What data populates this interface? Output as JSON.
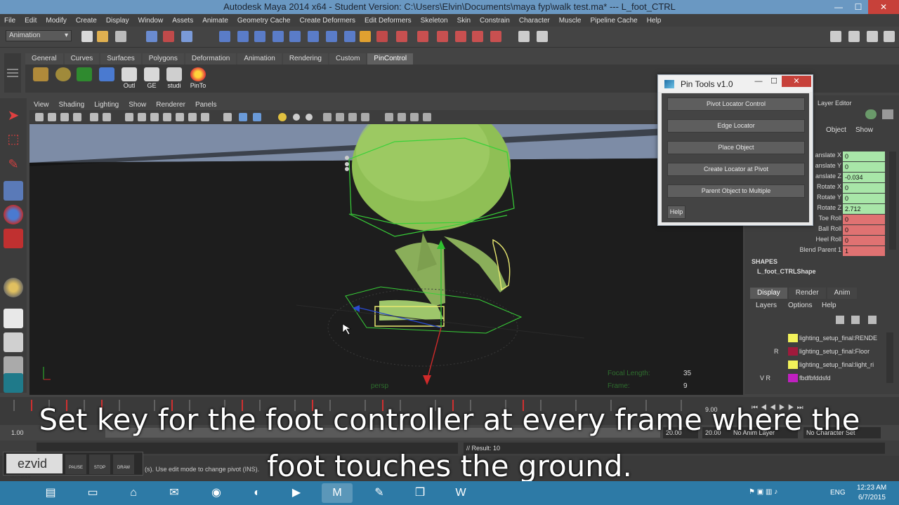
{
  "window": {
    "title": "Autodesk Maya 2014 x64 - Student Version: C:\\Users\\Elvin\\Documents\\maya fyp\\walk test.ma*   ---   L_foot_CTRL",
    "minimize": "—",
    "maximize": "☐",
    "close": "✕"
  },
  "menu": [
    "File",
    "Edit",
    "Modify",
    "Create",
    "Display",
    "Window",
    "Assets",
    "Animate",
    "Geometry Cache",
    "Create Deformers",
    "Edit Deformers",
    "Skeleton",
    "Skin",
    "Constrain",
    "Character",
    "Muscle",
    "Pipeline Cache",
    "Help"
  ],
  "status_line": {
    "mode": "Animation"
  },
  "shelf": {
    "tabs": [
      "General",
      "Curves",
      "Surfaces",
      "Polygons",
      "Deformation",
      "Animation",
      "Rendering",
      "Custom",
      "PinControl"
    ],
    "active_tab": "PinControl",
    "buttons": [
      "",
      "",
      "",
      "",
      "Outl",
      "GE",
      "studi",
      "PinTo"
    ]
  },
  "panel_menu": [
    "View",
    "Shading",
    "Lighting",
    "Show",
    "Renderer",
    "Panels"
  ],
  "viewport": {
    "hud": {
      "focal_length_label": "Focal Length:",
      "focal_length": "35",
      "frame_label": "Frame:",
      "frame": "9",
      "camera": "persp"
    }
  },
  "pin_tools": {
    "title": "Pin Tools v1.0",
    "buttons": [
      "Pivot Locator Control",
      "Edge Locator",
      "Place Object",
      "Create Locator at Pivot",
      "Parent Object to Multiple"
    ],
    "help": "Help"
  },
  "channel_box": {
    "header": "Layer Editor",
    "tabs": [
      "Object",
      "Show"
    ],
    "attributes": [
      {
        "label": "anslate X",
        "value": "0",
        "color": "green"
      },
      {
        "label": "anslate Y",
        "value": "0",
        "color": "green"
      },
      {
        "label": "anslate Z",
        "value": "-0.034",
        "color": "green"
      },
      {
        "label": "Rotate X",
        "value": "0",
        "color": "green"
      },
      {
        "label": "Rotate Y",
        "value": "0",
        "color": "green"
      },
      {
        "label": "Rotate Z",
        "value": "2.712",
        "color": "green"
      },
      {
        "label": "Toe Roll",
        "value": "0",
        "color": "red"
      },
      {
        "label": "Ball Roll",
        "value": "0",
        "color": "red"
      },
      {
        "label": "Heel Roll",
        "value": "0",
        "color": "red"
      },
      {
        "label": "Blend Parent 1",
        "value": "1",
        "color": "red"
      }
    ],
    "shapes_label": "SHAPES",
    "shape_name": "L_foot_CTRLShape"
  },
  "layer_editor": {
    "tabs": [
      "Display",
      "Render",
      "Anim"
    ],
    "menu": [
      "Layers",
      "Options",
      "Help"
    ],
    "layers": [
      {
        "flags": "",
        "name": "lighting_setup_final:RENDE",
        "color": "#f2f25a"
      },
      {
        "flags": "R",
        "name": "lighting_setup_final:Floor",
        "color": "#a01a3c"
      },
      {
        "flags": "",
        "name": "lighting_setup_final:light_ri",
        "color": "#f2f25a"
      },
      {
        "flags": "V  R",
        "name": "fbdfbfddsfd",
        "color": "#c020c0"
      }
    ]
  },
  "time_slider": {
    "current_frame": "9.00"
  },
  "range": {
    "start": "1.00",
    "end_a": "20.00",
    "end_b": "20.00",
    "anim_layer": "No Anim Layer",
    "char_set": "No Character Set"
  },
  "command_line": {
    "result": "// Result: 10"
  },
  "help_line": "... (s). Use edit mode to change pivot (INS).",
  "ezvid": {
    "logo": "ezvid",
    "sub": "RECORDER",
    "pause": "PAUSE",
    "stop": "STOP",
    "draw": "DRAW"
  },
  "subtitle": {
    "line1": "Set key for the foot controller at every frame where the",
    "line2": "foot touches the ground."
  },
  "taskbar": {
    "lang": "ENG",
    "time": "12:23 AM",
    "date": "6/7/2015"
  }
}
